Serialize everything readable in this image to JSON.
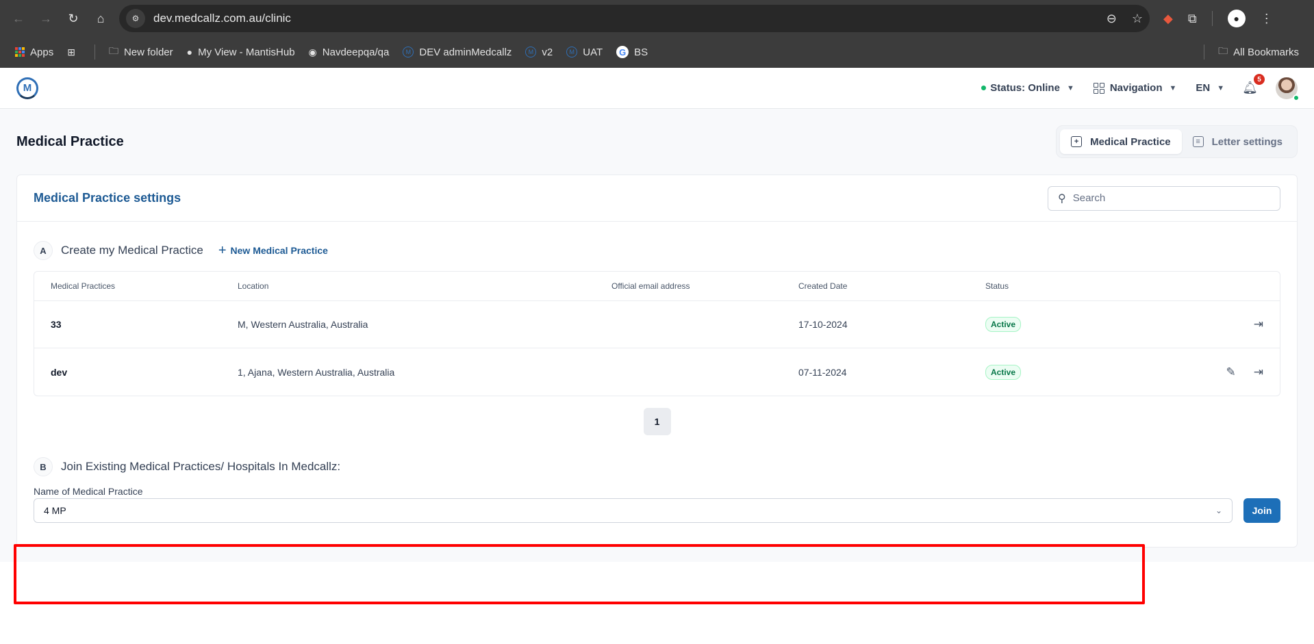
{
  "browser": {
    "url": "dev.medcallz.com.au/clinic",
    "bookmarks": [
      {
        "label": "Apps",
        "icon": "apps-grid-icon"
      },
      {
        "label": "",
        "icon": "tab-groups-icon"
      },
      {
        "label": "New folder",
        "icon": "folder-icon"
      },
      {
        "label": "My View - MantisHub",
        "icon": "mantis-icon"
      },
      {
        "label": "Navdeepqa/qa",
        "icon": "github-icon"
      },
      {
        "label": "DEV adminMedcallz",
        "icon": "medcallz-icon"
      },
      {
        "label": "v2",
        "icon": "medcallz-icon"
      },
      {
        "label": "UAT",
        "icon": "medcallz-icon"
      },
      {
        "label": "BS",
        "icon": "google-icon"
      }
    ],
    "all_bookmarks_label": "All Bookmarks"
  },
  "header": {
    "logo_letter": "M",
    "status_label": "Status: Online",
    "navigation_label": "Navigation",
    "language": "EN",
    "notification_count": "5",
    "status_color": "#12b76a"
  },
  "page": {
    "title": "Medical Practice",
    "tabs": [
      {
        "label": "Medical Practice",
        "active": true
      },
      {
        "label": "Letter settings",
        "active": false
      }
    ]
  },
  "card": {
    "title": "Medical Practice settings",
    "search_placeholder": "Search",
    "section_a": {
      "letter": "A",
      "title": "Create my Medical Practice",
      "new_button": "New Medical Practice"
    },
    "table": {
      "columns": [
        "Medical Practices",
        "Location",
        "Official email address",
        "Created Date",
        "Status"
      ],
      "rows": [
        {
          "name": "33",
          "location": "M, Western Australia, Australia",
          "email": "",
          "created": "17-10-2024",
          "status": "Active",
          "editable": false
        },
        {
          "name": "dev",
          "location": "1, Ajana, Western Australia, Australia",
          "email": "",
          "created": "07-11-2024",
          "status": "Active",
          "editable": true
        }
      ]
    },
    "pagination": {
      "current_page": "1"
    },
    "section_b": {
      "letter": "B",
      "title": "Join Existing Medical Practices/ Hospitals In Medcallz:",
      "field_label": "Name of Medical Practice",
      "selected_value": "4 MP",
      "join_button": "Join"
    }
  },
  "colors": {
    "brand": "#1d5a94",
    "primary_button": "#1d6fb8",
    "active_badge": "#067647",
    "highlight": "#ff0000"
  }
}
